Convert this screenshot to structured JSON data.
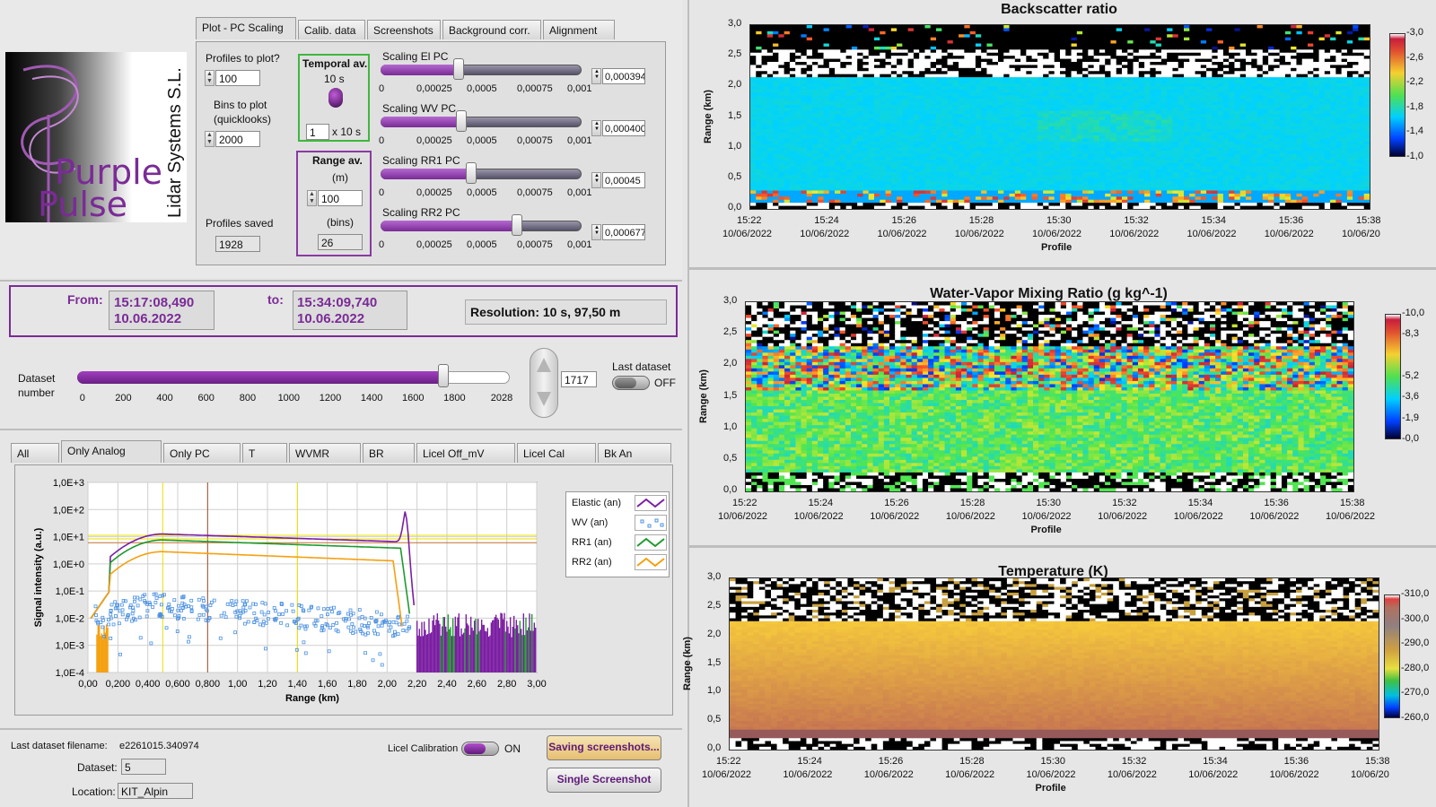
{
  "logo": {
    "line1": "Purple",
    "line2": "Pulse",
    "company": "Lidar Systems S.L."
  },
  "tabs_top": [
    {
      "label": "Plot - PC Scaling",
      "active": true
    },
    {
      "label": "Calib. data"
    },
    {
      "label": "Screenshots"
    },
    {
      "label": "Background corr."
    },
    {
      "label": "Alignment"
    }
  ],
  "controls": {
    "profiles_to_plot_label": "Profiles to plot?",
    "profiles_to_plot": "100",
    "bins_label_1": "Bins to plot",
    "bins_label_2": "(quicklooks)",
    "bins": "2000",
    "profiles_saved_label": "Profiles saved",
    "profiles_saved": "1928",
    "temporal_av_label": "Temporal av.",
    "temporal_av_value": "10 s",
    "temporal_av_mult": "1",
    "temporal_av_unit": "x 10 s",
    "range_av_label": "Range av.",
    "range_av_unit_m": "(m)",
    "range_av_m": "100",
    "range_av_unit_bins": "(bins)",
    "range_av_bins": "26"
  },
  "scalings": [
    {
      "label": "Scaling El PC",
      "value": "0,000394",
      "fraction": 0.39
    },
    {
      "label": "Scaling WV PC",
      "value": "0,000400",
      "fraction": 0.4
    },
    {
      "label": "Scaling RR1 PC",
      "value": "0,00045",
      "fraction": 0.45
    },
    {
      "label": "Scaling RR2 PC",
      "value": "0,000677",
      "fraction": 0.68
    }
  ],
  "scaling_ticks": [
    "0",
    "0,00025",
    "0,0005",
    "0,00075",
    "0,001"
  ],
  "time_range": {
    "from_label": "From:",
    "from_time": "15:17:08,490",
    "from_date": "10.06.2022",
    "to_label": "to:",
    "to_time": "15:34:09,740",
    "to_date": "10.06.2022",
    "resolution": "Resolution: 10 s, 97,50 m"
  },
  "dataset": {
    "label_1": "Dataset",
    "label_2": "number",
    "value": "1717",
    "max": 2028,
    "ticks": [
      "0",
      "200",
      "400",
      "600",
      "800",
      "1000",
      "1200",
      "1400",
      "1600",
      "1800",
      "2028"
    ],
    "last_dataset_label": "Last dataset",
    "last_dataset_state": "OFF"
  },
  "tabs_bottom": [
    {
      "label": "All"
    },
    {
      "label": "Only Analog",
      "active": true
    },
    {
      "label": "Only PC"
    },
    {
      "label": "T"
    },
    {
      "label": "WVMR"
    },
    {
      "label": "BR"
    },
    {
      "label": "Licel Off_mV"
    },
    {
      "label": "Licel Cal"
    },
    {
      "label": "Bk An"
    }
  ],
  "signal_plot": {
    "ylabel": "Signal intensity (a.u.)",
    "xlabel": "Range (km)",
    "yticks": [
      "1,0E+3",
      "1,0E+2",
      "1,0E+1",
      "1,0E+0",
      "1,0E-1",
      "1,0E-2",
      "1,0E-3",
      "1,0E-4"
    ],
    "xticks": [
      "0,00",
      "0,200",
      "0,400",
      "0,600",
      "0,800",
      "1,00",
      "1,20",
      "1,40",
      "1,60",
      "1,80",
      "2,00",
      "2,20",
      "2,40",
      "2,60",
      "2,80",
      "3,00"
    ],
    "legend": [
      {
        "name": "Elastic (an)",
        "color": "#7b1fa2"
      },
      {
        "name": "WV (an)",
        "color": "#4a90e2"
      },
      {
        "name": "RR1 (an)",
        "color": "#1f9a2e"
      },
      {
        "name": "RR2 (an)",
        "color": "#f5a00f"
      }
    ]
  },
  "footer": {
    "filename_label": "Last dataset filename:",
    "filename": "e2261015.340974",
    "dataset_label": "Dataset:",
    "dataset_value": "5",
    "location_label": "Location:",
    "location_value": "KIT_Alpin",
    "licel_label": "Licel Calibration",
    "licel_state": "ON",
    "saving_button": "Saving screenshots...",
    "single_button": "Single Screenshot"
  },
  "heatmaps": [
    {
      "title": "Backscatter ratio",
      "ylabel": "Range (km)",
      "xlabel": "Profile",
      "yticks": [
        "3,0",
        "2,5",
        "2,0",
        "1,5",
        "1,0",
        "0,5",
        "0,0"
      ],
      "xticks": [
        [
          "15:22",
          "10/06/2022"
        ],
        [
          "15:24",
          "10/06/2022"
        ],
        [
          "15:26",
          "10/06/2022"
        ],
        [
          "15:28",
          "10/06/2022"
        ],
        [
          "15:30",
          "10/06/2022"
        ],
        [
          "15:32",
          "10/06/2022"
        ],
        [
          "15:34",
          "10/06/2022"
        ],
        [
          "15:36",
          "10/06/2022"
        ],
        [
          "15:38",
          "10/06/20"
        ]
      ],
      "scale_ticks": [
        "3,0",
        "2,6",
        "2,2",
        "1,8",
        "1,4",
        "1,0"
      ]
    },
    {
      "title": "Water-Vapor Mixing Ratio  (g kg^-1)",
      "ylabel": "Range (km)",
      "xlabel": "Profile",
      "yticks": [
        "3,0",
        "2,5",
        "2,0",
        "1,5",
        "1,0",
        "0,5",
        "0,0"
      ],
      "xticks": [
        [
          "15:22",
          "10/06/2022"
        ],
        [
          "15:24",
          "10/06/2022"
        ],
        [
          "15:26",
          "10/06/2022"
        ],
        [
          "15:28",
          "10/06/2022"
        ],
        [
          "15:30",
          "10/06/2022"
        ],
        [
          "15:32",
          "10/06/2022"
        ],
        [
          "15:34",
          "10/06/2022"
        ],
        [
          "15:36",
          "10/06/2022"
        ],
        [
          "15:38",
          "10/06/2022"
        ]
      ],
      "scale_ticks": [
        "10,0",
        "8,3",
        "",
        "5,2",
        "3,6",
        "1,9",
        "0,0"
      ]
    },
    {
      "title": "Temperature (K)",
      "ylabel": "Range (km)",
      "xlabel": "Profile",
      "yticks": [
        "3,0",
        "2,5",
        "2,0",
        "1,5",
        "1,0",
        "0,5",
        "0,0"
      ],
      "xticks": [
        [
          "15:22",
          "10/06/2022"
        ],
        [
          "15:24",
          "10/06/2022"
        ],
        [
          "15:26",
          "10/06/2022"
        ],
        [
          "15:28",
          "10/06/2022"
        ],
        [
          "15:30",
          "10/06/2022"
        ],
        [
          "15:32",
          "10/06/2022"
        ],
        [
          "15:34",
          "10/06/2022"
        ],
        [
          "15:36",
          "10/06/2022"
        ],
        [
          "15:38",
          "10/06/20"
        ]
      ],
      "scale_ticks": [
        "310,0",
        "300,0",
        "290,0",
        "280,0",
        "270,0",
        "260,0"
      ]
    }
  ]
}
